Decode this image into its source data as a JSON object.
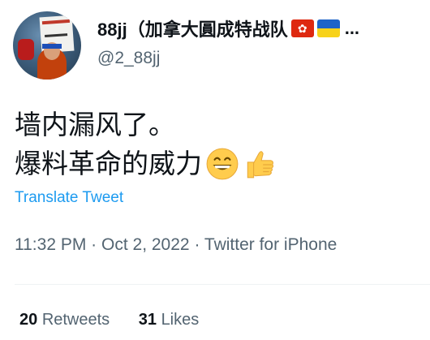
{
  "author": {
    "display_name": "88jj（加拿大圓成特战队",
    "flag_hk_icon": "hong-kong-flag-icon",
    "flag_ua_icon": "ukraine-flag-icon",
    "truncation": "...",
    "handle": "@2_88jj"
  },
  "tweet": {
    "lines": [
      "墙内漏风了。",
      "爆料革命的威力"
    ],
    "emojis": [
      "grinning-face-icon",
      "thumbs-up-icon"
    ]
  },
  "translate_label": "Translate Tweet",
  "meta": {
    "time": "11:32 PM",
    "separator": "·",
    "date": "Oct 2, 2022",
    "source": "Twitter for iPhone"
  },
  "stats": {
    "retweets_count": "20",
    "retweets_label": "Retweets",
    "likes_count": "31",
    "likes_label": "Likes"
  },
  "colors": {
    "text": "#0f1419",
    "secondary": "#536471",
    "link": "#1d9bf0",
    "divider": "#eff3f4"
  }
}
